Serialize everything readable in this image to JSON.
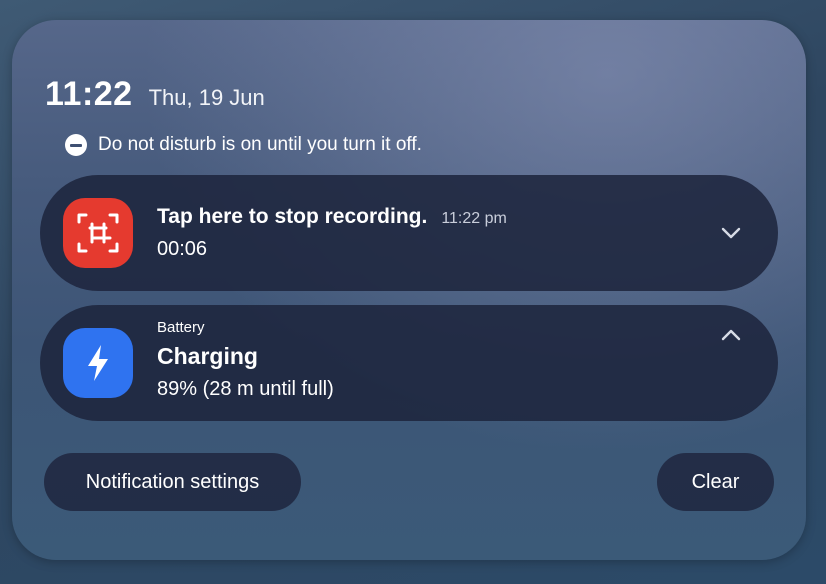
{
  "header": {
    "time": "11:22",
    "date": "Thu, 19 Jun"
  },
  "dnd": {
    "text": "Do not disturb is on until you turn it off.",
    "icon": "do-not-disturb-icon"
  },
  "notifications": [
    {
      "app_icon": "screen-record-icon",
      "icon_color": "#e53a2f",
      "title": "Tap here to stop recording.",
      "time": "11:22 pm",
      "subtitle": "00:06",
      "state": "collapsed"
    },
    {
      "app_icon": "lightning-bolt-icon",
      "icon_color": "#2f73f0",
      "app_name": "Battery",
      "title": "Charging",
      "subtitle": "89% (28 m until full)",
      "state": "expanded"
    }
  ],
  "footer": {
    "settings_label": "Notification settings",
    "clear_label": "Clear"
  }
}
